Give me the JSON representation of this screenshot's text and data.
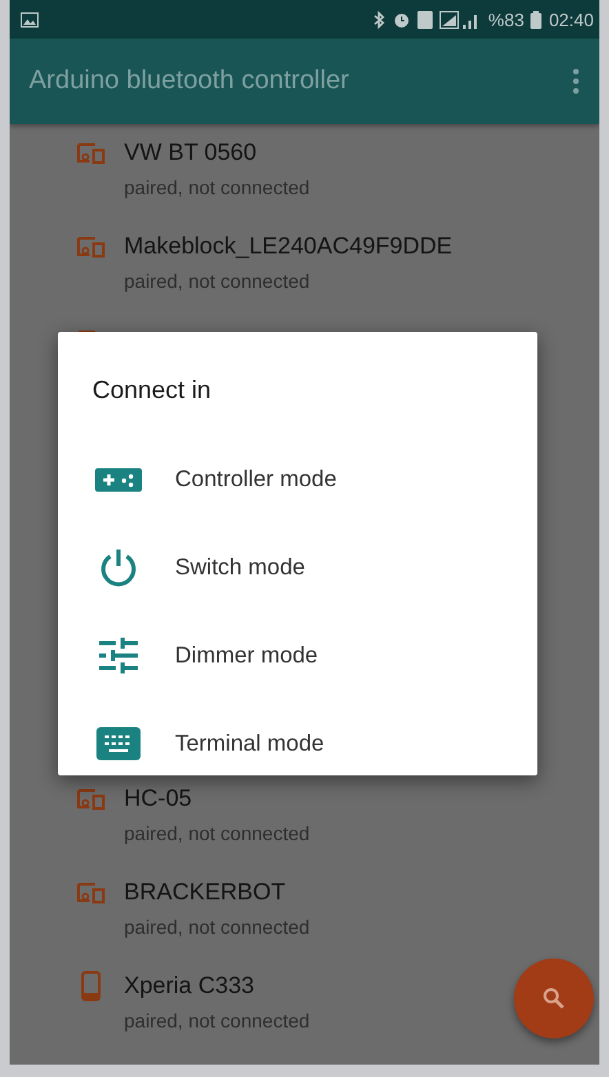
{
  "status_bar": {
    "battery": "%83",
    "time": "02:40"
  },
  "app_bar": {
    "title": "Arduino bluetooth controller"
  },
  "devices": [
    {
      "name": "VW BT 0560",
      "status": "paired, not connected",
      "kind": "computer"
    },
    {
      "name": "Makeblock_LE240AC49F9DDE",
      "status": "paired, not connected",
      "kind": "computer"
    },
    {
      "kind": "computer"
    },
    {
      "name": "HC-05",
      "status": "paired, not connected",
      "kind": "computer"
    },
    {
      "name": "BRACKERBOT",
      "status": "paired, not connected",
      "kind": "computer"
    },
    {
      "name": "Xperia C333",
      "status": "paired, not connected",
      "kind": "phone"
    }
  ],
  "dialog": {
    "title": "Connect in",
    "options": [
      {
        "label": "Controller mode",
        "kind": "controller"
      },
      {
        "label": "Switch mode",
        "kind": "switch"
      },
      {
        "label": "Dimmer mode",
        "kind": "dimmer"
      },
      {
        "label": "Terminal mode",
        "kind": "terminal"
      }
    ]
  }
}
